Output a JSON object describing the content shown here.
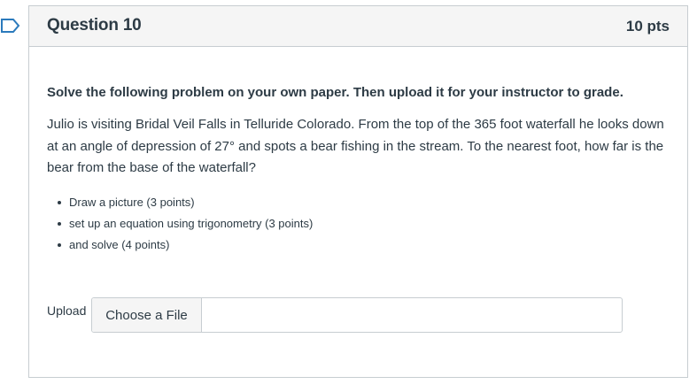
{
  "question": {
    "title": "Question 10",
    "points": "10 pts",
    "instruction": "Solve the following problem on your own paper. Then upload it for your instructor to grade.",
    "problem": "Julio is visiting Bridal Veil Falls in Telluride Colorado. From the top of the 365 foot waterfall he looks down at an angle of depression of 27° and spots a bear fishing in the stream. To the nearest foot, how far is the bear from the base of the waterfall?",
    "steps": [
      "Draw a picture (3 points)",
      "set up an equation using trigonometry (3 points)",
      "and solve (4 points)"
    ]
  },
  "upload": {
    "label": "Upload",
    "button_label": "Choose a File"
  },
  "icons": {
    "flag": "flag-outline-icon"
  },
  "colors": {
    "flag_stroke": "#2b7abc",
    "header_bg": "#f5f5f5",
    "border": "#c7cdd1",
    "text": "#2d3b45"
  }
}
